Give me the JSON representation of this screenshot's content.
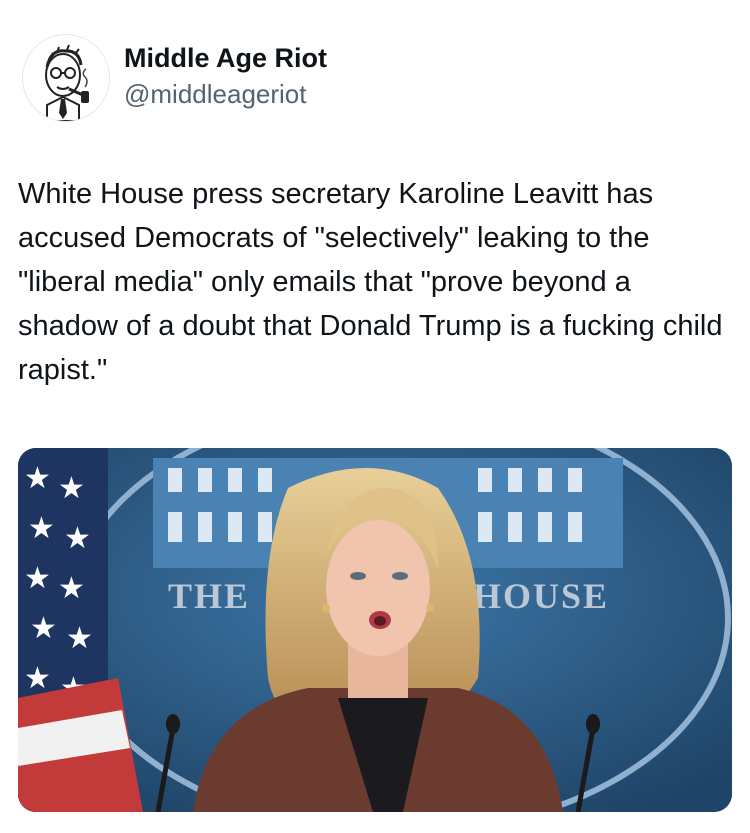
{
  "author": {
    "display_name": "Middle Age Riot",
    "handle": "@middleageriot",
    "avatar_icon": "cartoon-man-with-pipe-avatar"
  },
  "post": {
    "text": "White House press secretary Karoline Leavitt has accused Democrats of \"selectively\" leaking to the \"liberal media\" only emails that \"prove beyond a shadow of a doubt that Donald Trump is a fucking child rapist.\""
  },
  "media": {
    "description_icon": "press-briefing-photo",
    "seal_text_left": "THE",
    "seal_text_right": "HOUSE"
  },
  "colors": {
    "text": "#0f1419",
    "secondary_text": "#536471",
    "seal_blue": "#2e5d86"
  }
}
